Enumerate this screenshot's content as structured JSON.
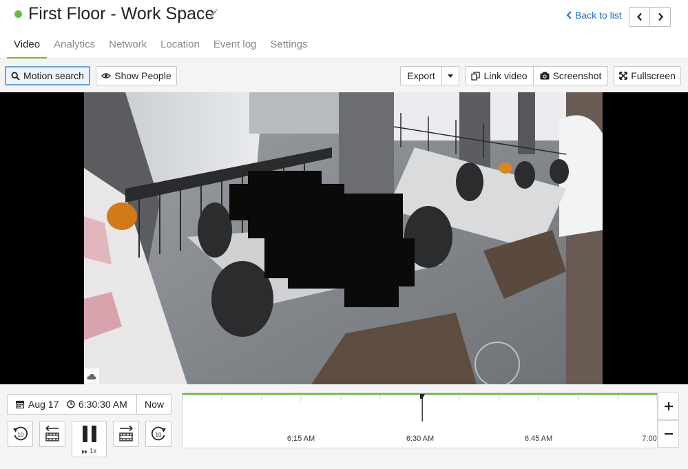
{
  "header": {
    "title": "First Floor - Work Space",
    "status_color": "#6cbb3c",
    "back_label": "Back to list"
  },
  "tabs": [
    {
      "label": "Video",
      "active": true
    },
    {
      "label": "Analytics",
      "active": false
    },
    {
      "label": "Network",
      "active": false
    },
    {
      "label": "Location",
      "active": false
    },
    {
      "label": "Event log",
      "active": false
    },
    {
      "label": "Settings",
      "active": false
    }
  ],
  "toolbar": {
    "motion_search": "Motion search",
    "show_people": "Show People",
    "export": "Export",
    "link_video": "Link video",
    "screenshot": "Screenshot",
    "fullscreen": "Fullscreen"
  },
  "playback": {
    "date": "Aug 17",
    "time": "6:30:30 AM",
    "now_label": "Now",
    "skip_back_seconds": "10",
    "skip_forward_seconds": "10",
    "speed": "1x"
  },
  "timeline": {
    "labels": [
      "6:15 AM",
      "6:30 AM",
      "6:45 AM",
      "7:00"
    ]
  },
  "colors": {
    "accent_green": "#6cbb3c",
    "link_blue": "#1a6fc9"
  }
}
